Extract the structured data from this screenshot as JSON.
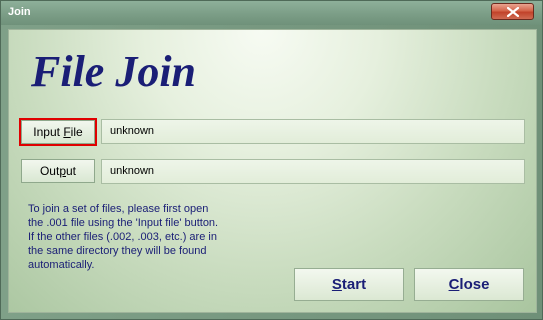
{
  "window": {
    "title": "Join"
  },
  "app": {
    "title": "File Join"
  },
  "input": {
    "button_pre": "Input ",
    "button_accel": "F",
    "button_post": "ile",
    "value": "unknown"
  },
  "output": {
    "button_pre": "Out",
    "button_accel": "p",
    "button_post": "ut",
    "value": "unknown"
  },
  "help": {
    "lines": [
      "To join a set of files, please first open",
      "the .001 file using the 'Input file' button.",
      "If the other files (.002, .003, etc.) are in",
      "the same directory they will be found",
      "automatically."
    ]
  },
  "actions": {
    "start_accel": "S",
    "start_rest": "tart",
    "close_accel": "C",
    "close_rest": "lose"
  },
  "icons": {
    "window_close": "close-icon"
  },
  "colors": {
    "title_text": "#1a1e76",
    "highlight": "#e00000"
  }
}
